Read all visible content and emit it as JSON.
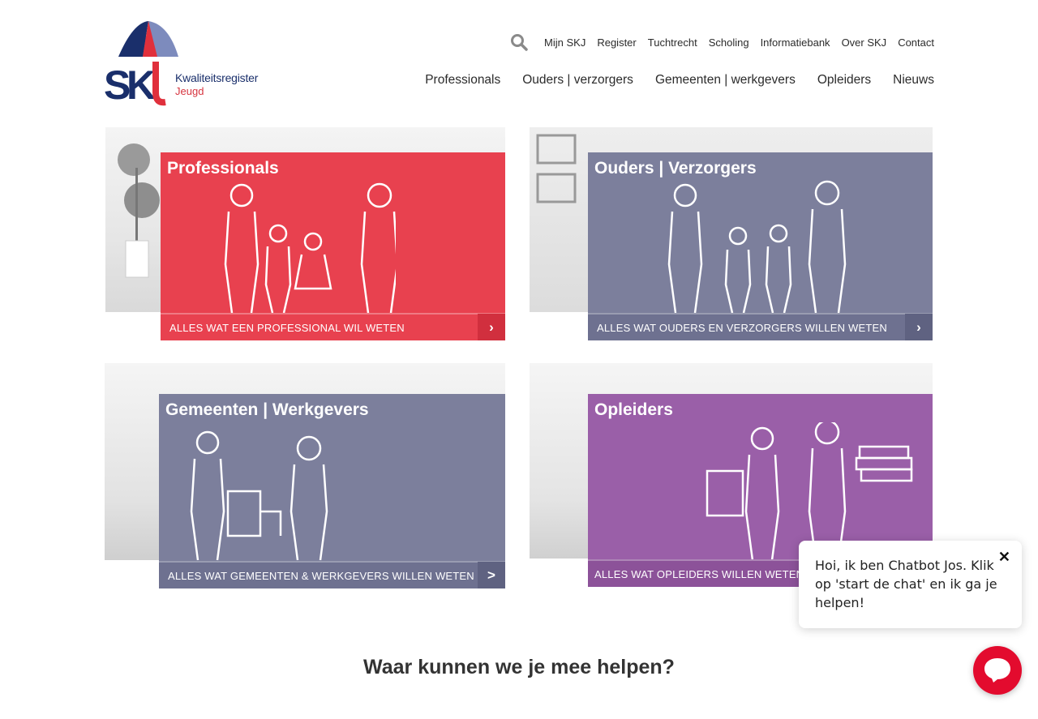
{
  "logo": {
    "line1": "Kwaliteitsregister",
    "line2": "Jeugd"
  },
  "topnav": [
    "Mijn SKJ",
    "Register",
    "Tuchtrecht",
    "Scholing",
    "Informatiebank",
    "Over SKJ",
    "Contact"
  ],
  "mainnav": [
    "Professionals",
    "Ouders | verzorgers",
    "Gemeenten | werkgevers",
    "Opleiders",
    "Nieuws"
  ],
  "tiles": [
    {
      "title": "Professionals",
      "bar": "ALLES WAT EEN PROFESSIONAL WIL WETEN",
      "arrow": "›"
    },
    {
      "title": "Ouders | Verzorgers",
      "bar": "ALLES WAT OUDERS EN VERZORGERS WILLEN WETEN",
      "arrow": "›"
    },
    {
      "title": "Gemeenten | Werkgevers",
      "bar": "ALLES WAT GEMEENTEN & WERKGEVERS WILLEN WETEN",
      "arrow": ">"
    },
    {
      "title": "Opleiders",
      "bar": "ALLES WAT OPLEIDERS WILLEN WETEN",
      "arrow": ">"
    }
  ],
  "help_heading": "Waar kunnen we je mee helpen?",
  "chat": {
    "message": "Hoi, ik ben Chatbot Jos. Klik op 'start de chat' en ik ga je helpen!",
    "close": "✕"
  },
  "colors": {
    "red": "#e8414f",
    "slate": "#7c7f9c",
    "purple": "#9a5fa8",
    "navy": "#1a2f6b"
  }
}
